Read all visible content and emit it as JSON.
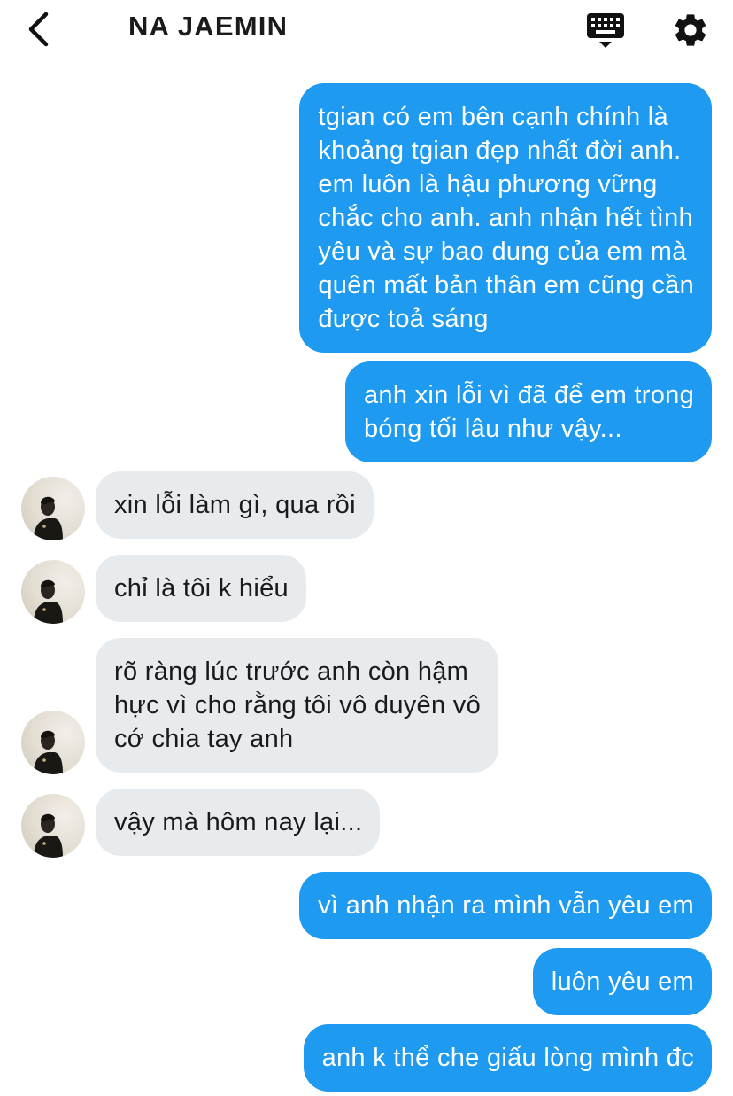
{
  "header": {
    "title": "NA JAEMIN",
    "back_icon": "chevron-left-icon",
    "keyboard_icon": "keyboard-icon",
    "settings_icon": "gear-icon"
  },
  "colors": {
    "outgoing_bubble": "#1e9bf0",
    "incoming_bubble": "#e8ebee",
    "text_dark": "#1a1a1a"
  },
  "messages": [
    {
      "side": "out",
      "lines": [
        "tgian có em bên cạnh chính là",
        "khoảng tgian đẹp nhất đời anh.",
        "em luôn là hậu phương vững",
        "chắc cho anh. anh nhận hết tình",
        "yêu và sự bao dung của em mà",
        "quên mất bản thân em cũng cần",
        "được toả sáng"
      ]
    },
    {
      "side": "out",
      "lines": [
        "anh xin lỗi vì đã để em trong",
        "bóng tối lâu như vậy..."
      ]
    },
    {
      "side": "in",
      "lines": [
        "xin lỗi làm gì, qua rồi"
      ]
    },
    {
      "side": "in",
      "lines": [
        "chỉ là tôi k hiểu"
      ]
    },
    {
      "side": "in",
      "lines": [
        "rõ ràng lúc trước anh còn hậm",
        "hực vì cho rằng tôi vô duyên vô",
        "cớ chia tay anh"
      ]
    },
    {
      "side": "in",
      "lines": [
        "vậy mà hôm nay lại..."
      ]
    },
    {
      "side": "out",
      "lines": [
        "vì anh nhận ra mình vẫn yêu em"
      ]
    },
    {
      "side": "out",
      "lines": [
        "luôn yêu em"
      ]
    },
    {
      "side": "out",
      "lines": [
        "anh k thể che giấu lòng mình đc"
      ]
    }
  ]
}
